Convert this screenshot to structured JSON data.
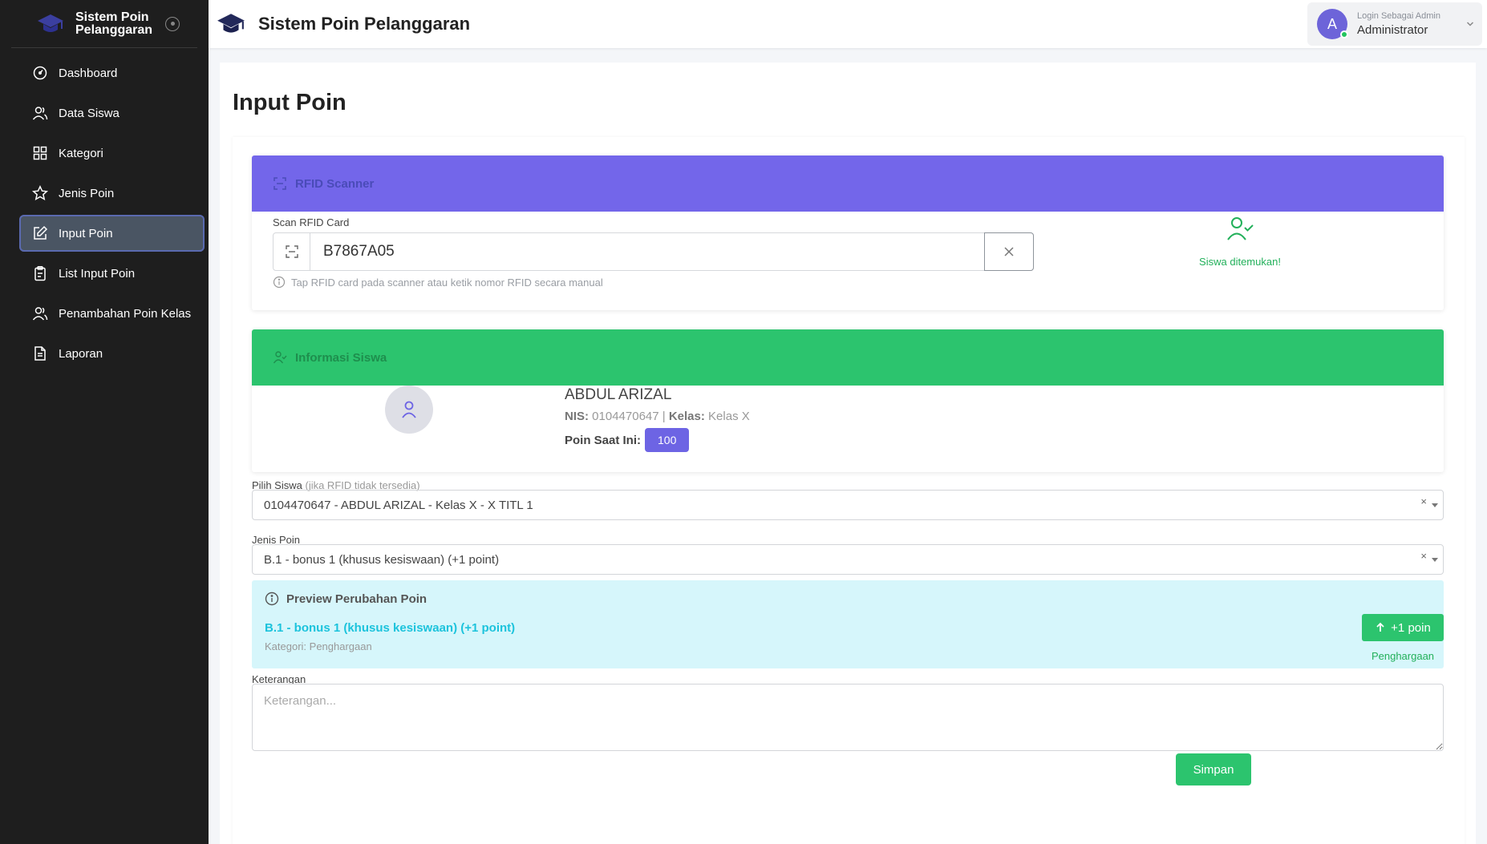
{
  "sidebar": {
    "brand": "Sistem Poin Pelanggaran",
    "items": [
      {
        "label": "Dashboard",
        "icon": "dashboard-icon"
      },
      {
        "label": "Data Siswa",
        "icon": "users-icon"
      },
      {
        "label": "Kategori",
        "icon": "grid-icon"
      },
      {
        "label": "Jenis Poin",
        "icon": "star-icon"
      },
      {
        "label": "Input Poin",
        "icon": "edit-icon",
        "active": true
      },
      {
        "label": "List Input Poin",
        "icon": "clipboard-icon"
      },
      {
        "label": "Penambahan Poin Kelas",
        "icon": "users-icon"
      },
      {
        "label": "Laporan",
        "icon": "document-icon"
      }
    ]
  },
  "topbar": {
    "title": "Sistem Poin Pelanggaran",
    "user_initial": "A",
    "user_role": "Login Sebagai Admin",
    "user_name": "Administrator"
  },
  "page": {
    "title": "Input Poin"
  },
  "rfid": {
    "header": "RFID Scanner",
    "scan_label": "Scan RFID Card",
    "value": "B7867A05",
    "hint": "Tap RFID card pada scanner atau ketik nomor RFID secara manual",
    "status": "Siswa ditemukan!"
  },
  "student": {
    "header": "Informasi Siswa",
    "name": "ABDUL ARIZAL",
    "nis_label": "NIS:",
    "nis": "0104470647",
    "kelas_label": "Kelas:",
    "kelas": "Kelas X",
    "points_label": "Poin Saat Ini:",
    "points": "100"
  },
  "form": {
    "pilih_label": "Pilih Siswa",
    "pilih_hint": "(jika RFID tidak tersedia)",
    "pilih_value": "0104470647 - ABDUL ARIZAL - Kelas X - X TITL 1",
    "jenis_label": "Jenis Poin",
    "jenis_value": "B.1 - bonus 1 (khusus kesiswaan) (+1 point)",
    "keterangan_label": "Keterangan",
    "keterangan_placeholder": "Keterangan...",
    "save_label": "Simpan"
  },
  "preview": {
    "title": "Preview Perubahan Poin",
    "name": "B.1 - bonus 1 (khusus kesiswaan) (+1 point)",
    "category": "Kategori: Penghargaan",
    "change": "+1 poin",
    "type": "Penghargaan"
  },
  "colors": {
    "rfid_header": "#7366ea",
    "info_header": "#2cc46e",
    "preview_bg": "#d6f6fb",
    "success": "#2cc46e",
    "badge": "#6d64e4"
  }
}
